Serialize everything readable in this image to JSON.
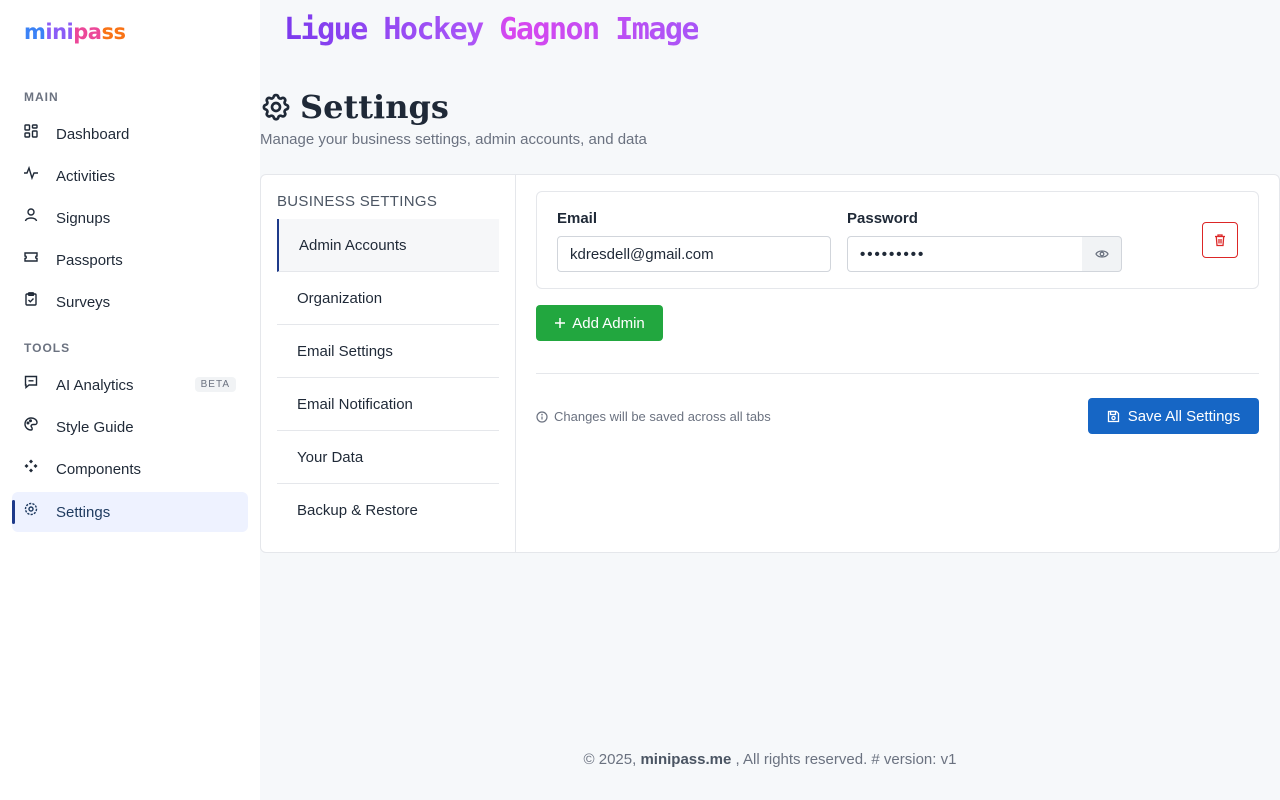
{
  "brand": {
    "logo_parts": [
      "m",
      "ini",
      "pa",
      "ss"
    ]
  },
  "sidebar": {
    "sections": [
      {
        "label": "MAIN",
        "items": [
          {
            "label": "Dashboard",
            "icon": "dashboard-icon"
          },
          {
            "label": "Activities",
            "icon": "activity-icon"
          },
          {
            "label": "Signups",
            "icon": "user-icon"
          },
          {
            "label": "Passports",
            "icon": "ticket-icon"
          },
          {
            "label": "Surveys",
            "icon": "clipboard-icon"
          }
        ]
      },
      {
        "label": "TOOLS",
        "items": [
          {
            "label": "AI Analytics",
            "icon": "chat-icon",
            "badge": "BETA"
          },
          {
            "label": "Style Guide",
            "icon": "palette-icon"
          },
          {
            "label": "Components",
            "icon": "components-icon"
          },
          {
            "label": "Settings",
            "icon": "settings-icon",
            "active": true
          }
        ]
      }
    ]
  },
  "header": {
    "org_name": "Ligue Hockey Gagnon Image"
  },
  "page": {
    "title": "Settings",
    "subtitle": "Manage your business settings, admin accounts, and data"
  },
  "settings_tabs": {
    "heading": "BUSINESS SETTINGS",
    "items": [
      "Admin Accounts",
      "Organization",
      "Email Settings",
      "Email Notification",
      "Your Data",
      "Backup & Restore"
    ],
    "active": "Admin Accounts"
  },
  "admin_form": {
    "email_label": "Email",
    "email_value": "kdresdell@gmail.com",
    "password_label": "Password",
    "password_value": "•••••••••",
    "add_button": "Add Admin",
    "hint": "Changes will be saved across all tabs",
    "save_button": "Save All Settings"
  },
  "footer": {
    "prefix": "© 2025,",
    "brand": "minipass.me",
    "suffix": ", All rights reserved. # version: v1"
  },
  "colors": {
    "accent_green": "#22a73f",
    "accent_blue": "#1666c5",
    "danger": "#dc2626"
  }
}
